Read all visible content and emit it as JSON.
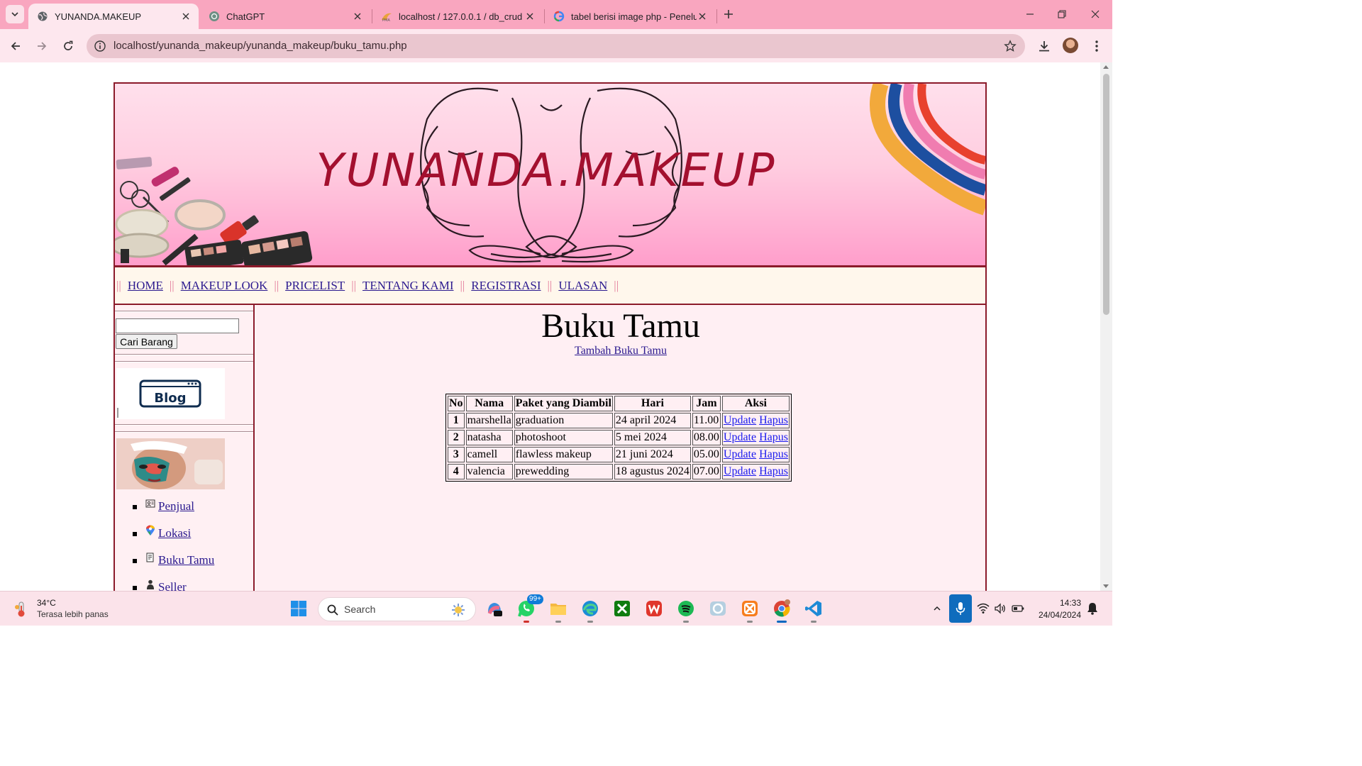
{
  "browser": {
    "tabs": [
      {
        "title": "YUNANDA.MAKEUP",
        "icon": "globe-icon",
        "active": true
      },
      {
        "title": "ChatGPT",
        "icon": "chatgpt-icon",
        "active": false
      },
      {
        "title": "localhost / 127.0.0.1 / db_crud /",
        "icon": "phpmyadmin-icon",
        "active": false
      },
      {
        "title": "tabel berisi image php - Penelu",
        "icon": "google-icon",
        "active": false
      }
    ],
    "url": "localhost/yunanda_makeup/yunanda_makeup/buku_tamu.php",
    "colors": {
      "tabstrip": "#f9a6bf",
      "toolbar": "#fde7ee"
    }
  },
  "site": {
    "banner_title": "YUNANDA.MAKEUP",
    "nav": [
      "HOME",
      "MAKEUP LOOK",
      "PRICELIST",
      "TENTANG KAMI",
      "REGISTRASI",
      "ULASAN"
    ],
    "sidebar": {
      "search_value": "",
      "search_button": "Cari Barang",
      "blog_label": "Blog",
      "links": [
        {
          "label": "Penjual",
          "icon": "contact-card-icon"
        },
        {
          "label": "Lokasi",
          "icon": "map-pin-icon"
        },
        {
          "label": "Buku Tamu",
          "icon": "document-icon"
        },
        {
          "label": "Seller",
          "icon": "person-icon"
        }
      ]
    },
    "content": {
      "title": "Buku Tamu",
      "add_link": "Tambah Buku Tamu",
      "table": {
        "headers": [
          "No",
          "Nama",
          "Paket yang Diambil",
          "Hari",
          "Jam",
          "Aksi"
        ],
        "rows": [
          {
            "no": "1",
            "nama": "marshella",
            "paket": "graduation",
            "hari": "24 april 2024",
            "jam": "11.00"
          },
          {
            "no": "2",
            "nama": "natasha",
            "paket": "photoshoot",
            "hari": "5 mei 2024",
            "jam": "08.00"
          },
          {
            "no": "3",
            "nama": "camell",
            "paket": "flawless makeup",
            "hari": "21 juni 2024",
            "jam": "05.00"
          },
          {
            "no": "4",
            "nama": "valencia",
            "paket": "prewedding",
            "hari": "18 agustus 2024",
            "jam": "07.00"
          }
        ],
        "update_label": "Update",
        "delete_label": "Hapus"
      }
    },
    "colors": {
      "border": "#8b1a2a",
      "title": "#a3102f",
      "link": "#2b1a8f",
      "content_bg": "#ffeff3"
    }
  },
  "taskbar": {
    "weather_temp": "34°C",
    "weather_desc": "Terasa lebih panas",
    "search_placeholder": "Search",
    "whatsapp_badge": "99+",
    "time": "14:33",
    "date": "24/04/2024",
    "apps": [
      "copilot-icon",
      "whatsapp-icon",
      "file-explorer-icon",
      "edge-icon",
      "xbox-icon",
      "wps-icon",
      "spotify-icon",
      "photos-icon",
      "xampp-icon",
      "chrome-icon",
      "vscode-icon"
    ]
  }
}
